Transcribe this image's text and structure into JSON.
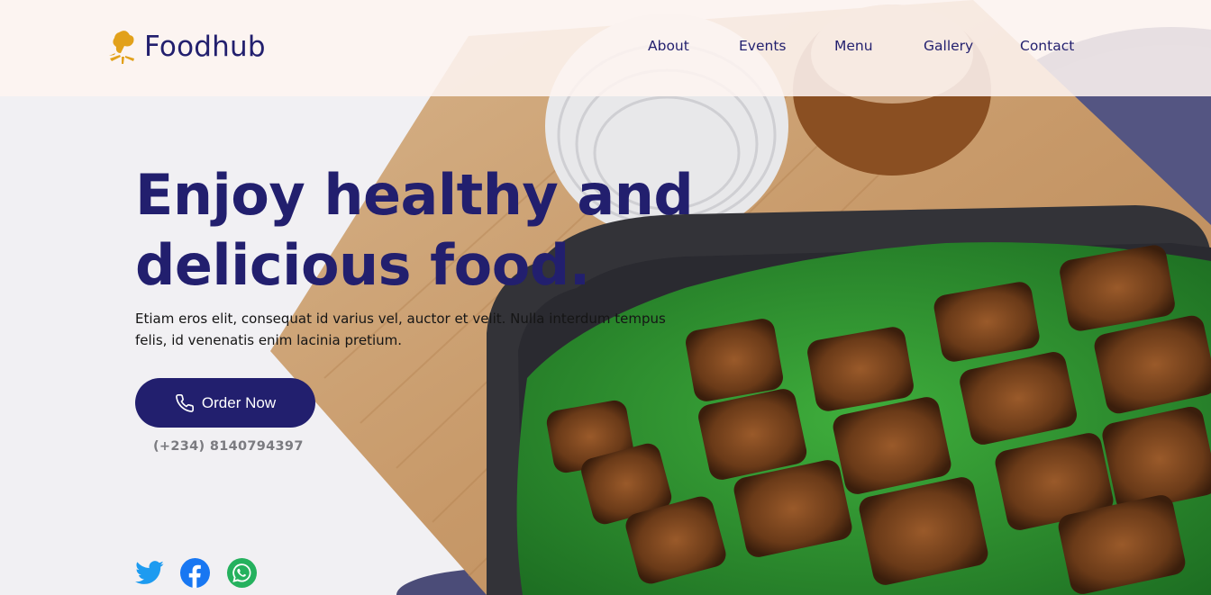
{
  "brand": {
    "name": "Foodhub",
    "logo_icon": "chef-hat-icon"
  },
  "nav": {
    "items": [
      {
        "label": "About"
      },
      {
        "label": "Events"
      },
      {
        "label": "Menu"
      },
      {
        "label": "Gallery"
      },
      {
        "label": "Contact"
      }
    ]
  },
  "hero": {
    "title_line1": "Enjoy healthy and",
    "title_line2": "delicious food.",
    "description": "Etiam eros elit, consequat id varius vel, auctor et velit. Nulla interdum tempus felis, id venenatis enim lacinia pretium.",
    "cta_label": "Order Now",
    "cta_icon": "phone-icon",
    "phone_number": "(+234) 8140794397"
  },
  "social": [
    {
      "name": "twitter-icon",
      "color": "#1d9bf0"
    },
    {
      "name": "facebook-icon",
      "color": "#1877f2"
    },
    {
      "name": "whatsapp-icon",
      "color": "#25b15e"
    }
  ],
  "colors": {
    "primary": "#221f6e",
    "accent": "#e2a11b",
    "nav_bg": "#fdf4f0"
  }
}
